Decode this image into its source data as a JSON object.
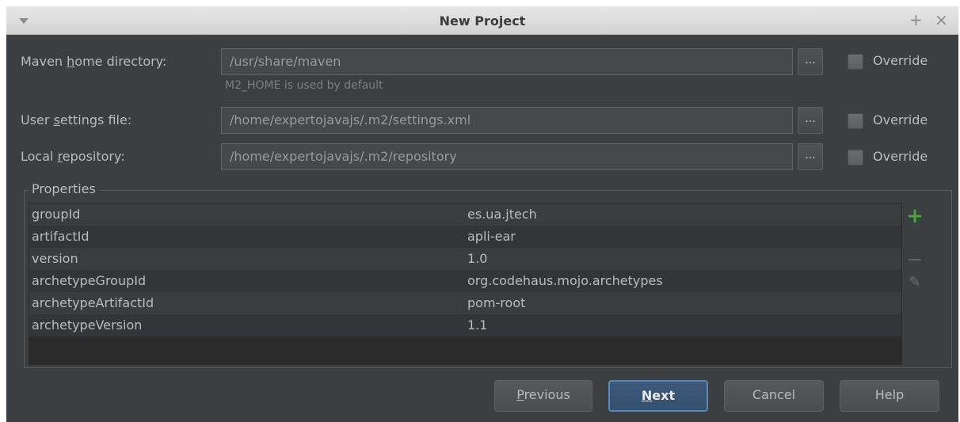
{
  "window": {
    "title": "New Project"
  },
  "maven": {
    "home_label_pre": "Maven ",
    "home_label_mn": "h",
    "home_label_post": "ome directory:",
    "home_value": "/usr/share/maven",
    "home_hint": "M2_HOME is used by default",
    "settings_label_pre": "User ",
    "settings_label_mn": "s",
    "settings_label_post": "ettings file:",
    "settings_value": "/home/expertojavajs/.m2/settings.xml",
    "repo_label_pre": "Local ",
    "repo_label_mn": "r",
    "repo_label_post": "epository:",
    "repo_value": "/home/expertojavajs/.m2/repository",
    "browse_label": "...",
    "override_label": "Override"
  },
  "properties": {
    "title": "Properties",
    "rows": [
      {
        "key": "groupId",
        "value": "es.ua.jtech"
      },
      {
        "key": "artifactId",
        "value": "apli-ear"
      },
      {
        "key": "version",
        "value": "1.0"
      },
      {
        "key": "archetypeGroupId",
        "value": "org.codehaus.mojo.archetypes"
      },
      {
        "key": "archetypeArtifactId",
        "value": "pom-root"
      },
      {
        "key": "archetypeVersion",
        "value": "1.1"
      }
    ],
    "tools": {
      "add_glyph": "+",
      "edit_glyph": "✎"
    }
  },
  "buttons": {
    "previous_mn": "P",
    "previous_rest": "revious",
    "next_mn": "N",
    "next_rest": "ext",
    "cancel": "Cancel",
    "help": "Help"
  },
  "titlebar": {
    "pin_glyph": "+",
    "close_glyph": "×"
  },
  "icons": [
    "menu-arrow-icon",
    "pin-icon",
    "close-icon",
    "add-icon",
    "remove-icon",
    "edit-icon"
  ]
}
